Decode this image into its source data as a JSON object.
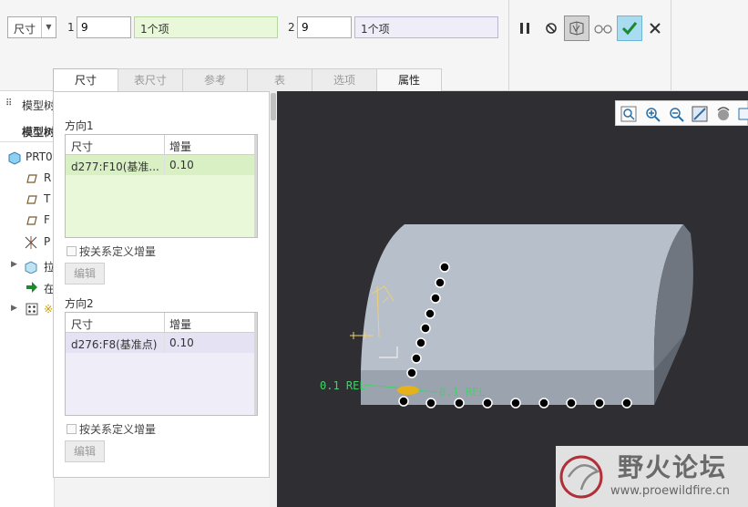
{
  "toolbar": {
    "type_select": "尺寸",
    "direction1": {
      "index": "1",
      "value": "9",
      "reference": "1个项"
    },
    "direction2": {
      "index": "2",
      "value": "9",
      "reference": "1个项"
    }
  },
  "tabs": [
    {
      "label": "尺寸",
      "state": "selected"
    },
    {
      "label": "表尺寸",
      "state": "disabled"
    },
    {
      "label": "参考",
      "state": "disabled"
    },
    {
      "label": "表",
      "state": "disabled"
    },
    {
      "label": "选项",
      "state": "disabled"
    },
    {
      "label": "属性",
      "state": "enabled"
    }
  ],
  "model_tree": {
    "header": "模型树",
    "tab": "模型树",
    "items": [
      {
        "label": "PRT0",
        "icon": "part-icon"
      },
      {
        "label": "R",
        "icon": "datum-plane-icon"
      },
      {
        "label": "T",
        "icon": "datum-plane-icon"
      },
      {
        "label": "F",
        "icon": "datum-plane-icon"
      },
      {
        "label": "P",
        "icon": "coordinate-system-icon"
      },
      {
        "label": "拉",
        "icon": "extrude-icon"
      },
      {
        "label": "在",
        "icon": "insert-here-icon"
      },
      {
        "label": "※",
        "icon": "pattern-icon"
      }
    ]
  },
  "dimensions_panel": {
    "direction1": {
      "label": "方向1",
      "columns": [
        "尺寸",
        "增量"
      ],
      "rows": [
        [
          "d277:F10(基准...",
          "0.10"
        ]
      ],
      "relation_checkbox": "按关系定义增量",
      "edit_button": "编辑"
    },
    "direction2": {
      "label": "方向2",
      "columns": [
        "尺寸",
        "增量"
      ],
      "rows": [
        [
          "d276:F8(基准点)",
          "0.10"
        ]
      ],
      "relation_checkbox": "按关系定义增量",
      "edit_button": "编辑"
    }
  },
  "viewport": {
    "annotation_left": "0.1 REL",
    "annotation_right": "0.1 REL",
    "pattern_points_dir1": 8,
    "pattern_points_dir2": 9,
    "colors": {
      "background": "#2f2f33",
      "model": "#b7bfca",
      "annotation": "#45d16a"
    }
  },
  "watermark": {
    "title": "野火论坛",
    "url": "www.proewildfire.cn"
  },
  "colors": {
    "dir1_fill": "#e8f8d8",
    "dir2_fill": "#efeef8",
    "ok_button": "#a9dcf0"
  }
}
